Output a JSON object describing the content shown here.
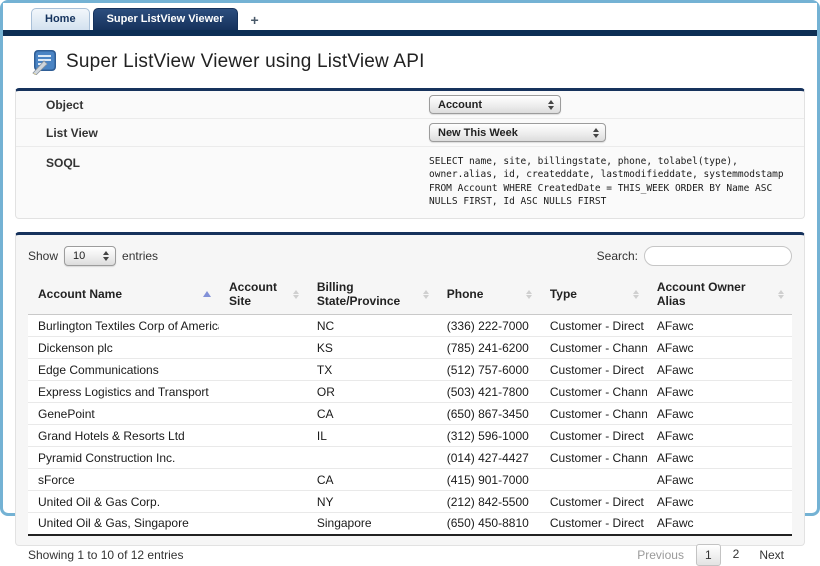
{
  "tab_bar": {
    "tabs": [
      {
        "label": "Home",
        "active": false
      },
      {
        "label": "Super ListView Viewer",
        "active": true
      }
    ],
    "new_tab_label": "+"
  },
  "page": {
    "title": "Super ListView Viewer using ListView API"
  },
  "form": {
    "object": {
      "label": "Object",
      "value": "Account"
    },
    "list_view": {
      "label": "List View",
      "value": "New This Week"
    },
    "soql": {
      "label": "SOQL",
      "value": "SELECT name, site, billingstate, phone, tolabel(type), owner.alias, id, createddate, lastmodifieddate, systemmodstamp FROM Account WHERE CreatedDate = THIS_WEEK ORDER BY Name ASC NULLS FIRST, Id ASC NULLS FIRST"
    }
  },
  "datatable": {
    "length_control": {
      "prefix": "Show",
      "value": "10",
      "suffix": "entries"
    },
    "search": {
      "label": "Search:",
      "value": ""
    },
    "columns": [
      "Account Name",
      "Account Site",
      "Billing State/Province",
      "Phone",
      "Type",
      "Account Owner Alias"
    ],
    "sorted_column": "Account Name",
    "sort_direction": "asc",
    "rows": [
      [
        "Burlington Textiles Corp of America",
        "",
        "NC",
        "(336) 222-7000",
        "Customer - Direct",
        "AFawc"
      ],
      [
        "Dickenson plc",
        "",
        "KS",
        "(785) 241-6200",
        "Customer - Channel",
        "AFawc"
      ],
      [
        "Edge Communications",
        "",
        "TX",
        "(512) 757-6000",
        "Customer - Direct",
        "AFawc"
      ],
      [
        "Express Logistics and Transport",
        "",
        "OR",
        "(503) 421-7800",
        "Customer - Channel",
        "AFawc"
      ],
      [
        "GenePoint",
        "",
        "CA",
        "(650) 867-3450",
        "Customer - Channel",
        "AFawc"
      ],
      [
        "Grand Hotels & Resorts Ltd",
        "",
        "IL",
        "(312) 596-1000",
        "Customer - Direct",
        "AFawc"
      ],
      [
        "Pyramid Construction Inc.",
        "",
        "",
        "(014) 427-4427",
        "Customer - Channel",
        "AFawc"
      ],
      [
        "sForce",
        "",
        "CA",
        "(415) 901-7000",
        "",
        "AFawc"
      ],
      [
        "United Oil & Gas Corp.",
        "",
        "NY",
        "(212) 842-5500",
        "Customer - Direct",
        "AFawc"
      ],
      [
        "United Oil & Gas, Singapore",
        "",
        "Singapore",
        "(650) 450-8810",
        "Customer - Direct",
        "AFawc"
      ]
    ],
    "info": "Showing 1 to 10 of 12 entries",
    "pagination": {
      "previous": "Previous",
      "pages": [
        "1",
        "2"
      ],
      "active_page": "1",
      "next": "Next"
    }
  },
  "colors": {
    "navy": "#16325c",
    "frame_blue": "#74b2d4",
    "sort_active_arrow": "#8291d8",
    "panel_background": "#fafafa"
  }
}
